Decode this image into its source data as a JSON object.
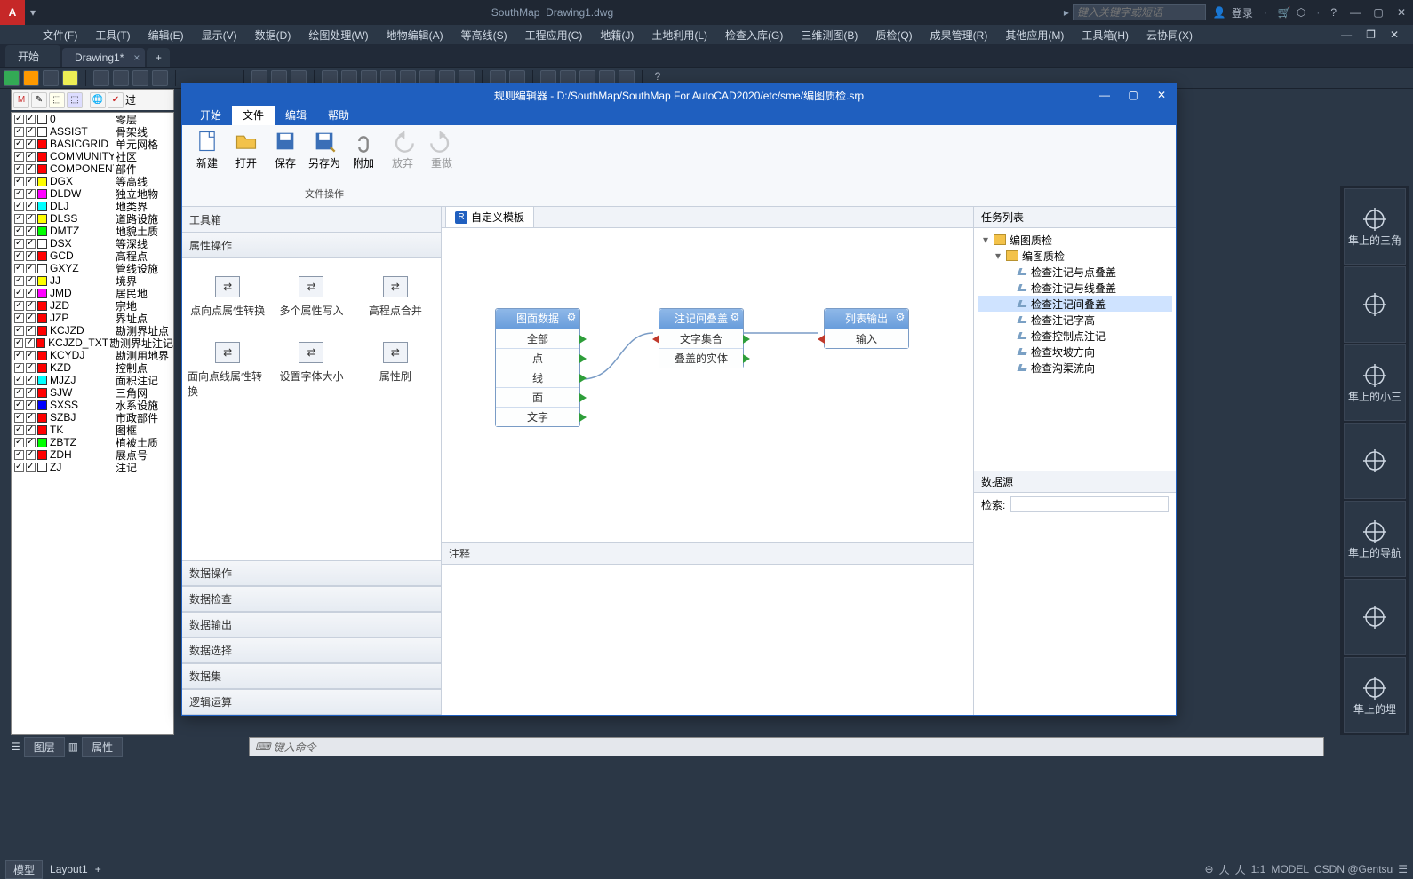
{
  "acad": {
    "title_app": "SouthMap",
    "title_doc": "Drawing1.dwg",
    "search_ph": "键入关键字或短语",
    "login": "登录",
    "menus": [
      "文件(F)",
      "工具(T)",
      "编辑(E)",
      "显示(V)",
      "数据(D)",
      "绘图处理(W)",
      "地物编辑(A)",
      "等高线(S)",
      "工程应用(C)",
      "地籍(J)",
      "土地利用(L)",
      "检查入库(G)",
      "三维测图(B)",
      "质检(Q)",
      "成果管理(R)",
      "其他应用(M)",
      "工具箱(H)",
      "云协同(X)"
    ],
    "file_tabs": [
      {
        "label": "开始",
        "active": false,
        "dirty": false
      },
      {
        "label": "Drawing1*",
        "active": true,
        "dirty": true
      }
    ],
    "layer_toolbar_hint": "过",
    "cmdline_hint": "键入命令",
    "model_tab": "模型",
    "layout_tab": "Layout1",
    "bottom_tabs": [
      "图层",
      "属性"
    ],
    "status_right": [
      "1:1",
      "MODEL",
      "CSDN @Gentsu"
    ]
  },
  "layers": [
    {
      "c": "#ffffff",
      "code": "0",
      "name": "零层"
    },
    {
      "c": "#ffffff",
      "code": "ASSIST",
      "name": "骨架线"
    },
    {
      "c": "#ff0000",
      "code": "BASICGRID",
      "name": "单元网格"
    },
    {
      "c": "#ff0000",
      "code": "COMMUNITY",
      "name": "社区"
    },
    {
      "c": "#ff0000",
      "code": "COMPONENT",
      "name": "部件"
    },
    {
      "c": "#ffff00",
      "code": "DGX",
      "name": "等高线"
    },
    {
      "c": "#ff00ff",
      "code": "DLDW",
      "name": "独立地物"
    },
    {
      "c": "#00ffff",
      "code": "DLJ",
      "name": "地类界"
    },
    {
      "c": "#ffff00",
      "code": "DLSS",
      "name": "道路设施"
    },
    {
      "c": "#00ff00",
      "code": "DMTZ",
      "name": "地貌土质"
    },
    {
      "c": "#ffffff",
      "code": "DSX",
      "name": "等深线"
    },
    {
      "c": "#ff0000",
      "code": "GCD",
      "name": "高程点"
    },
    {
      "c": "#ffffff",
      "code": "GXYZ",
      "name": "管线设施"
    },
    {
      "c": "#ffff00",
      "code": "JJ",
      "name": "境界"
    },
    {
      "c": "#ff00ff",
      "code": "JMD",
      "name": "居民地"
    },
    {
      "c": "#ff0000",
      "code": "JZD",
      "name": "宗地"
    },
    {
      "c": "#ff0000",
      "code": "JZP",
      "name": "界址点"
    },
    {
      "c": "#ff0000",
      "code": "KCJZD",
      "name": "勘测界址点"
    },
    {
      "c": "#ff0000",
      "code": "KCJZD_TXT",
      "name": "勘测界址注记"
    },
    {
      "c": "#ff0000",
      "code": "KCYDJ",
      "name": "勘测用地界"
    },
    {
      "c": "#ff0000",
      "code": "KZD",
      "name": "控制点"
    },
    {
      "c": "#00ffff",
      "code": "MJZJ",
      "name": "面积注记"
    },
    {
      "c": "#ff0000",
      "code": "SJW",
      "name": "三角网"
    },
    {
      "c": "#0000ff",
      "code": "SXSS",
      "name": "水系设施"
    },
    {
      "c": "#ff0000",
      "code": "SZBJ",
      "name": "市政部件"
    },
    {
      "c": "#ff0000",
      "code": "TK",
      "name": "图框"
    },
    {
      "c": "#00ff00",
      "code": "ZBTZ",
      "name": "植被土质"
    },
    {
      "c": "#ff0000",
      "code": "ZDH",
      "name": "展点号"
    },
    {
      "c": "#ffffff",
      "code": "ZJ",
      "name": "注记"
    }
  ],
  "right_tiles": [
    "隼上的三角",
    "",
    "隼上的小三",
    "",
    "隼上的导航",
    "",
    "隼上的埋"
  ],
  "dlg": {
    "title": "规则编辑器 - D:/SouthMap/SouthMap For AutoCAD2020/etc/sme/编图质检.srp",
    "tabs": [
      "开始",
      "文件",
      "编辑",
      "帮助"
    ],
    "active_tab": "文件",
    "ribbon": {
      "buttons": [
        "新建",
        "打开",
        "保存",
        "另存为",
        "附加",
        "放弃",
        "重做"
      ],
      "group_label": "文件操作"
    },
    "toolbox": {
      "header": "工具箱",
      "section": "属性操作",
      "items": [
        "点向点属性转换",
        "多个属性写入",
        "高程点合并",
        "面向点线属性转换",
        "设置字体大小",
        "属性刷"
      ],
      "accordion": [
        "数据操作",
        "数据检查",
        "数据输出",
        "数据选择",
        "数据集",
        "逻辑运算"
      ]
    },
    "canvas": {
      "tab": "自定义模板",
      "node1": {
        "title": "图面数据",
        "rows": [
          "全部",
          "点",
          "线",
          "面",
          "文字"
        ]
      },
      "node2": {
        "title": "注记间叠盖",
        "rows": [
          "文字集合",
          "叠盖的实体"
        ]
      },
      "node3": {
        "title": "列表输出",
        "rows": [
          "输入"
        ]
      },
      "annot_label": "注释"
    },
    "task": {
      "header": "任务列表",
      "root": "编图质检",
      "sub": "编图质检",
      "rules": [
        "检查注记与点叠盖",
        "检查注记与线叠盖",
        "检查注记间叠盖",
        "检查注记字高",
        "检查控制点注记",
        "检查坎坡方向",
        "检查沟渠流向"
      ],
      "selected": "检查注记间叠盖",
      "datasrc_header": "数据源",
      "search_label": "检索:"
    }
  }
}
